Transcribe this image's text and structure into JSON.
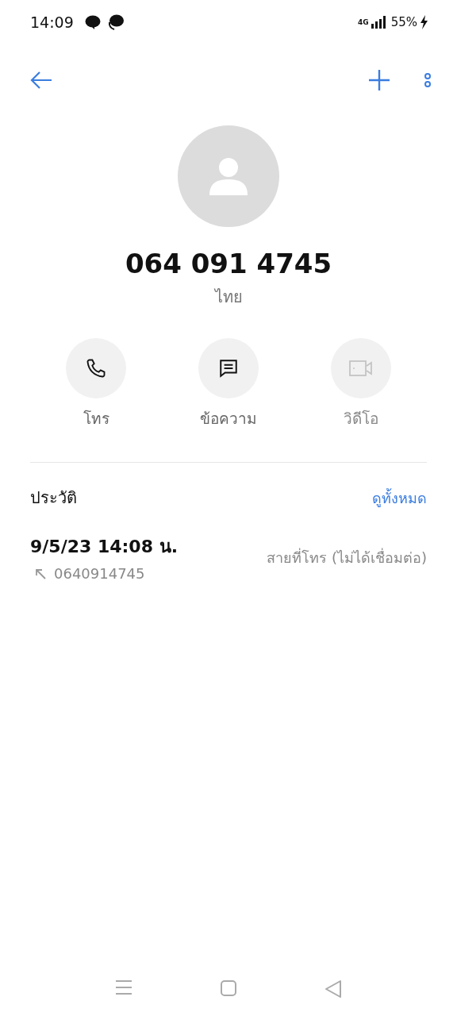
{
  "status_bar": {
    "time": "14:09",
    "network": "4G",
    "battery": "55%",
    "charging": true
  },
  "contact": {
    "number": "064 091 4745",
    "location": "ไทย"
  },
  "actions": [
    {
      "kind": "call",
      "label": "โทร",
      "disabled": false
    },
    {
      "kind": "message",
      "label": "ข้อความ",
      "disabled": false
    },
    {
      "kind": "video",
      "label": "วิดีโอ",
      "disabled": true
    }
  ],
  "history": {
    "title": "ประวัติ",
    "see_all": "ดูทั้งหมด",
    "entries": [
      {
        "datetime": "9/5/23 14:08 น.",
        "number": "0640914745",
        "status": "สายที่โทร (ไม่ได้เชื่อมต่อ)"
      }
    ]
  }
}
